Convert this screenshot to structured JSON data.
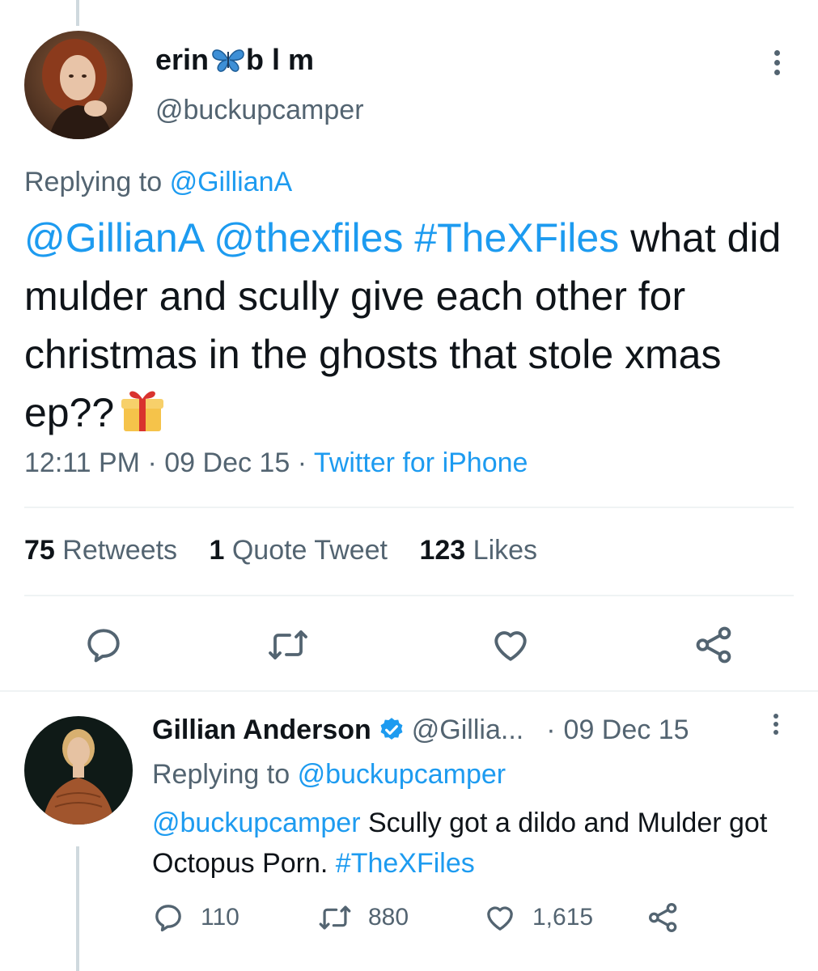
{
  "main_tweet": {
    "display_name": "erin",
    "name_suffix": "b l m",
    "handle": "@buckupcamper",
    "replying_prefix": "Replying to",
    "replying_to": "@GillianA",
    "mentions": [
      "@GillianA",
      "@thexfiles",
      "#TheXFiles"
    ],
    "body": "what did mulder and scully give each other for christmas in the ghosts that stole xmas ep??",
    "time": "12:11 PM",
    "date": "09 Dec 15",
    "client": "Twitter for iPhone",
    "separator": "·",
    "stats": {
      "retweets_count": "75",
      "retweets_label": "Retweets",
      "quotes_count": "1",
      "quotes_label": "Quote Tweet",
      "likes_count": "123",
      "likes_label": "Likes"
    },
    "actions": [
      "reply-icon",
      "retweet-icon",
      "like-icon",
      "share-icon"
    ]
  },
  "reply_tweet": {
    "display_name": "Gillian Anderson",
    "handle": "@Gillia...",
    "separator": "·",
    "date": "09 Dec 15",
    "replying_prefix": "Replying to",
    "replying_to": "@buckupcamper",
    "mention": "@buckupcamper",
    "body": "Scully got a dildo and Mulder got Octopus Porn.",
    "hashtag": "#TheXFiles",
    "counts": {
      "replies": "110",
      "retweets": "880",
      "likes": "1,615"
    }
  },
  "colors": {
    "link": "#1d9bf0",
    "text": "#0f1419",
    "secondary": "#536471",
    "divider": "#eff3f4",
    "verified": "#1d9bf0"
  }
}
